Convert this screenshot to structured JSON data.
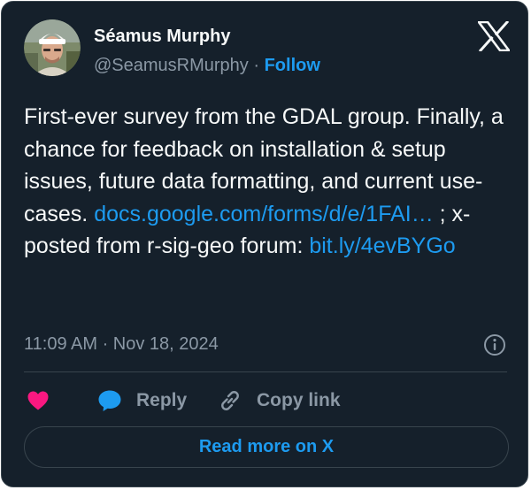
{
  "author": {
    "name": "Séamus Murphy",
    "handle": "@SeamusRMurphy",
    "separator": " · ",
    "follow_label": "Follow",
    "avatar_icon": "user-photo"
  },
  "brand_icon": "x-logo-icon",
  "tweet": {
    "text_part1": "First-ever survey from the GDAL group. Finally, a chance for feedback on installation & setup issues, future data formatting, and current use-cases. ",
    "link1": "docs.google.com/forms/d/e/1FAI…",
    "text_part2": " ; x-posted from r-sig-geo forum: ",
    "link2": "bit.ly/4evBYGo"
  },
  "meta": {
    "timestamp": "11:09 AM · Nov 18, 2024",
    "info_icon": "info-icon"
  },
  "actions": {
    "like_icon": "heart-icon",
    "reply_label": "Reply",
    "reply_icon": "speech-bubble-icon",
    "copy_label": "Copy link",
    "copy_icon": "link-icon"
  },
  "read_more_label": "Read more on X",
  "colors": {
    "background": "#15202b",
    "border": "#38444d",
    "text": "#f7f9f9",
    "muted": "#8b98a5",
    "accent": "#1d9bf0",
    "like": "#f91880"
  }
}
